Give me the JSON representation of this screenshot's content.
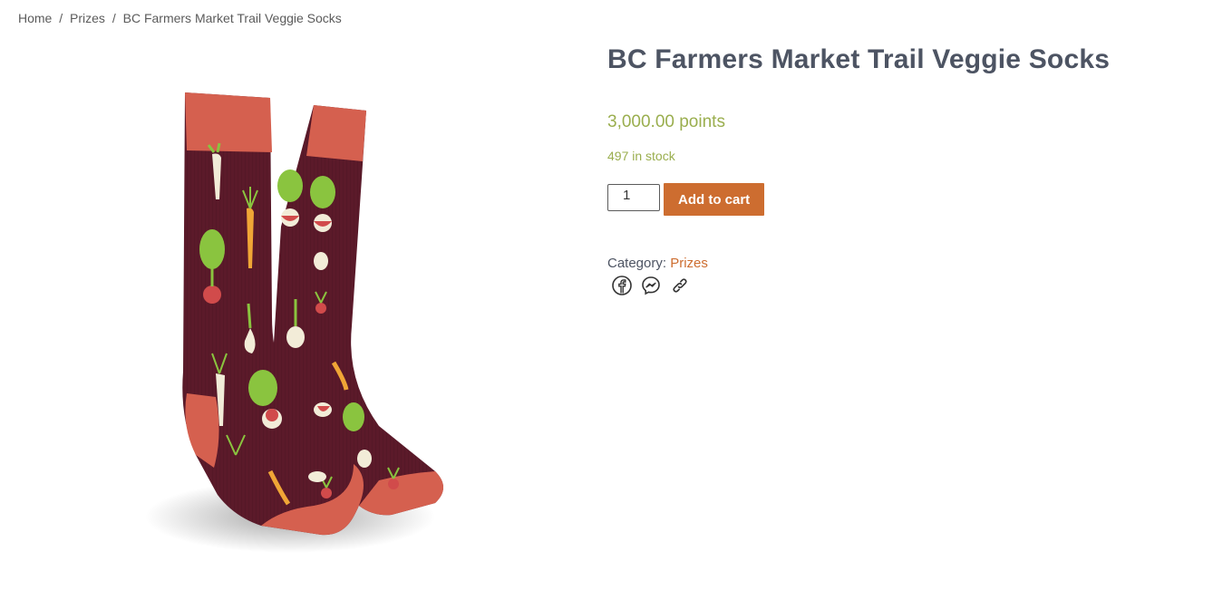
{
  "breadcrumb": {
    "home": "Home",
    "sep1": "/",
    "category": "Prizes",
    "sep2": "/",
    "current": "BC Farmers Market Trail Veggie Socks"
  },
  "product": {
    "title": "BC Farmers Market Trail Veggie Socks",
    "price": "3,000.00 points",
    "stock": "497 in stock",
    "quantity": "1",
    "add_to_cart_label": "Add to cart",
    "category_label": "Category:",
    "category_value": "Prizes",
    "image_icon": "veggie-socks-illustration"
  },
  "share": {
    "icons": [
      "facebook-icon",
      "messenger-icon",
      "link-icon"
    ]
  },
  "colors": {
    "title": "#4d5463",
    "price_green": "#9aae4e",
    "accent_orange": "#cd6d30",
    "sock_body": "#5b1a2a",
    "sock_cuff": "#d5604f"
  }
}
